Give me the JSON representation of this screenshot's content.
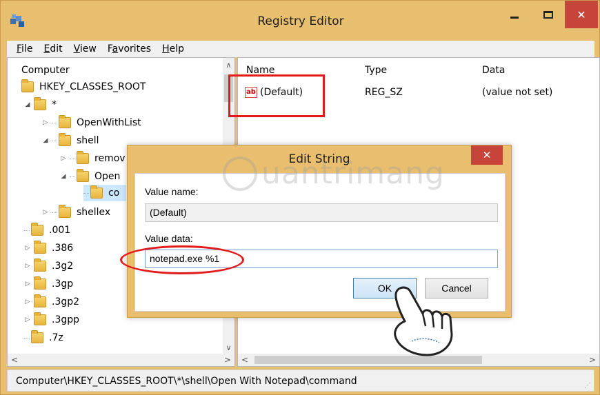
{
  "window": {
    "title": "Registry Editor",
    "close_glyph": "✕"
  },
  "menu": [
    {
      "prefix": "",
      "accel": "F",
      "rest": "ile"
    },
    {
      "prefix": "",
      "accel": "E",
      "rest": "dit"
    },
    {
      "prefix": "",
      "accel": "V",
      "rest": "iew"
    },
    {
      "prefix": "F",
      "accel": "a",
      "rest": "vorites"
    },
    {
      "prefix": "",
      "accel": "H",
      "rest": "elp"
    }
  ],
  "tree": {
    "root": "Computer",
    "hive": "HKEY_CLASSES_ROOT",
    "star": "*",
    "openwithlist": "OpenWithList",
    "shell": "shell",
    "remove": "remov",
    "open": "Open",
    "command": "co",
    "shellex": "shellex",
    "ext": [
      ".001",
      ".386",
      ".3g2",
      ".3gp",
      ".3gp2",
      ".3gpp",
      ".7z"
    ]
  },
  "list": {
    "columns": {
      "name": "Name",
      "type": "Type",
      "data": "Data"
    },
    "rows": [
      {
        "name": "(Default)",
        "type": "REG_SZ",
        "data": "(value not set)"
      }
    ],
    "icon_text": "ab"
  },
  "dialog": {
    "title": "Edit String",
    "close_glyph": "✕",
    "value_name_label": "Value name:",
    "value_name": "(Default)",
    "value_data_label": "Value data:",
    "value_data": "notepad.exe %1",
    "ok_label": "OK",
    "cancel_label": "Cancel"
  },
  "watermark": "uantrimang",
  "status": "Computer\\HKEY_CLASSES_ROOT\\*\\shell\\Open With Notepad\\command"
}
